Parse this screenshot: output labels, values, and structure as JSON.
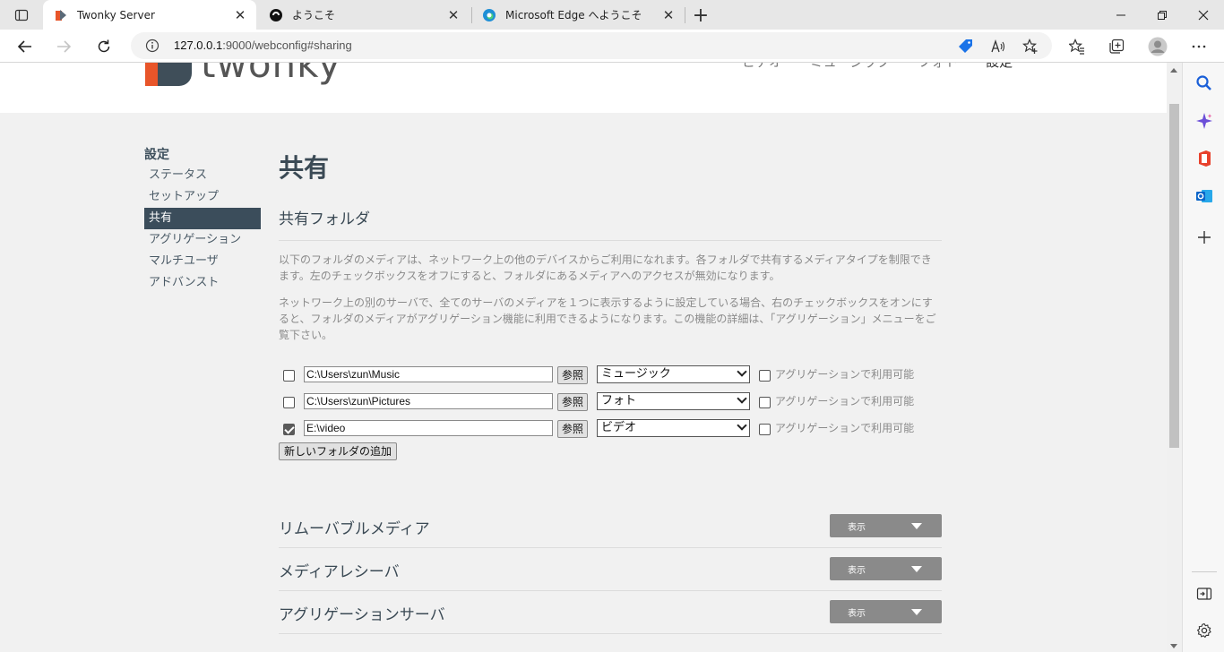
{
  "browser": {
    "tabs": [
      {
        "title": "Twonky Server",
        "active": true
      },
      {
        "title": "ようこそ",
        "active": false
      },
      {
        "title": "Microsoft Edge へようこそ",
        "active": false
      }
    ],
    "url": {
      "host": "127.0.0.1",
      "rest": ":9000/webconfig#sharing"
    }
  },
  "site": {
    "logo_text": "twonky",
    "topnav": [
      "ビデオ",
      "ミュージック",
      "フォト",
      "設定"
    ]
  },
  "leftnav": {
    "heading": "設定",
    "items": [
      "ステータス",
      "セットアップ",
      "共有",
      "アグリゲーション",
      "マルチユーザ",
      "アドバンスト"
    ],
    "active_index": 2
  },
  "main": {
    "title": "共有",
    "section_title": "共有フォルダ",
    "desc1": "以下のフォルダのメディアは、ネットワーク上の他のデバイスからご利用になれます。各フォルダで共有するメディアタイプを制限できます。左のチェックボックスをオフにすると、フォルダにあるメディアへのアクセスが無効になります。",
    "desc2": "ネットワーク上の別のサーバで、全てのサーバのメディアを１つに表示するように設定している場合、右のチェックボックスをオンにすると、フォルダのメディアがアグリゲーション機能に利用できるようになります。この機能の詳細は、「アグリゲーション」メニューをご覧下さい。",
    "browse_label": "参照",
    "agg_label": "アグリゲーションで利用可能",
    "folders": [
      {
        "enabled": false,
        "path": "C:\\Users\\zun\\Music",
        "type": "ミュージック",
        "aggregation": false
      },
      {
        "enabled": false,
        "path": "C:\\Users\\zun\\Pictures",
        "type": "フォト",
        "aggregation": false
      },
      {
        "enabled": true,
        "path": "E:\\video",
        "type": "ビデオ",
        "aggregation": false
      }
    ],
    "add_folder_label": "新しいフォルダの追加",
    "show_label": "表示",
    "sections": [
      "リムーバブルメディア",
      "メディアレシーバ",
      "アグリゲーションサーバ"
    ]
  },
  "colors": {
    "accent": "#3b4d5b",
    "show_button": "#8a8a8a",
    "logo_orange": "#e8552a"
  }
}
